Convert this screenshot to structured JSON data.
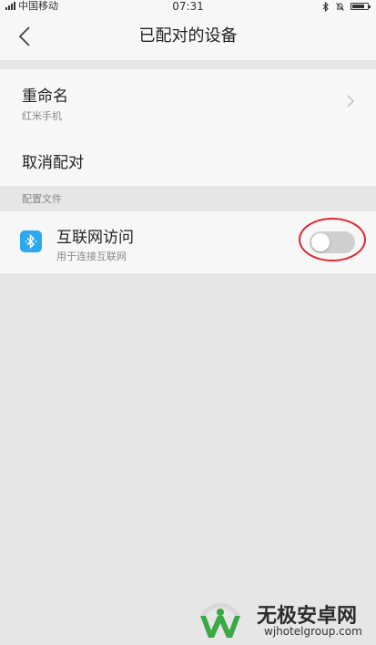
{
  "status_bar": {
    "carrier": "中国移动",
    "time": "07:31",
    "battery_level": 0.85
  },
  "header": {
    "title": "已配对的设备"
  },
  "rename": {
    "title": "重命名",
    "device_name": "红米手机"
  },
  "unpair": {
    "label": "取消配对"
  },
  "profiles": {
    "section_label": "配置文件",
    "internet_access": {
      "title": "互联网访问",
      "subtitle": "用于连接互联网",
      "enabled": false
    }
  },
  "watermark": {
    "title": "无极安卓网",
    "url": "wjhotelgroup.com"
  },
  "colors": {
    "bluetooth_icon": "#2aa8f0",
    "highlight_ring": "#e0262f",
    "watermark_green": "#39a845",
    "toggle_off": "#cfcfcf"
  }
}
